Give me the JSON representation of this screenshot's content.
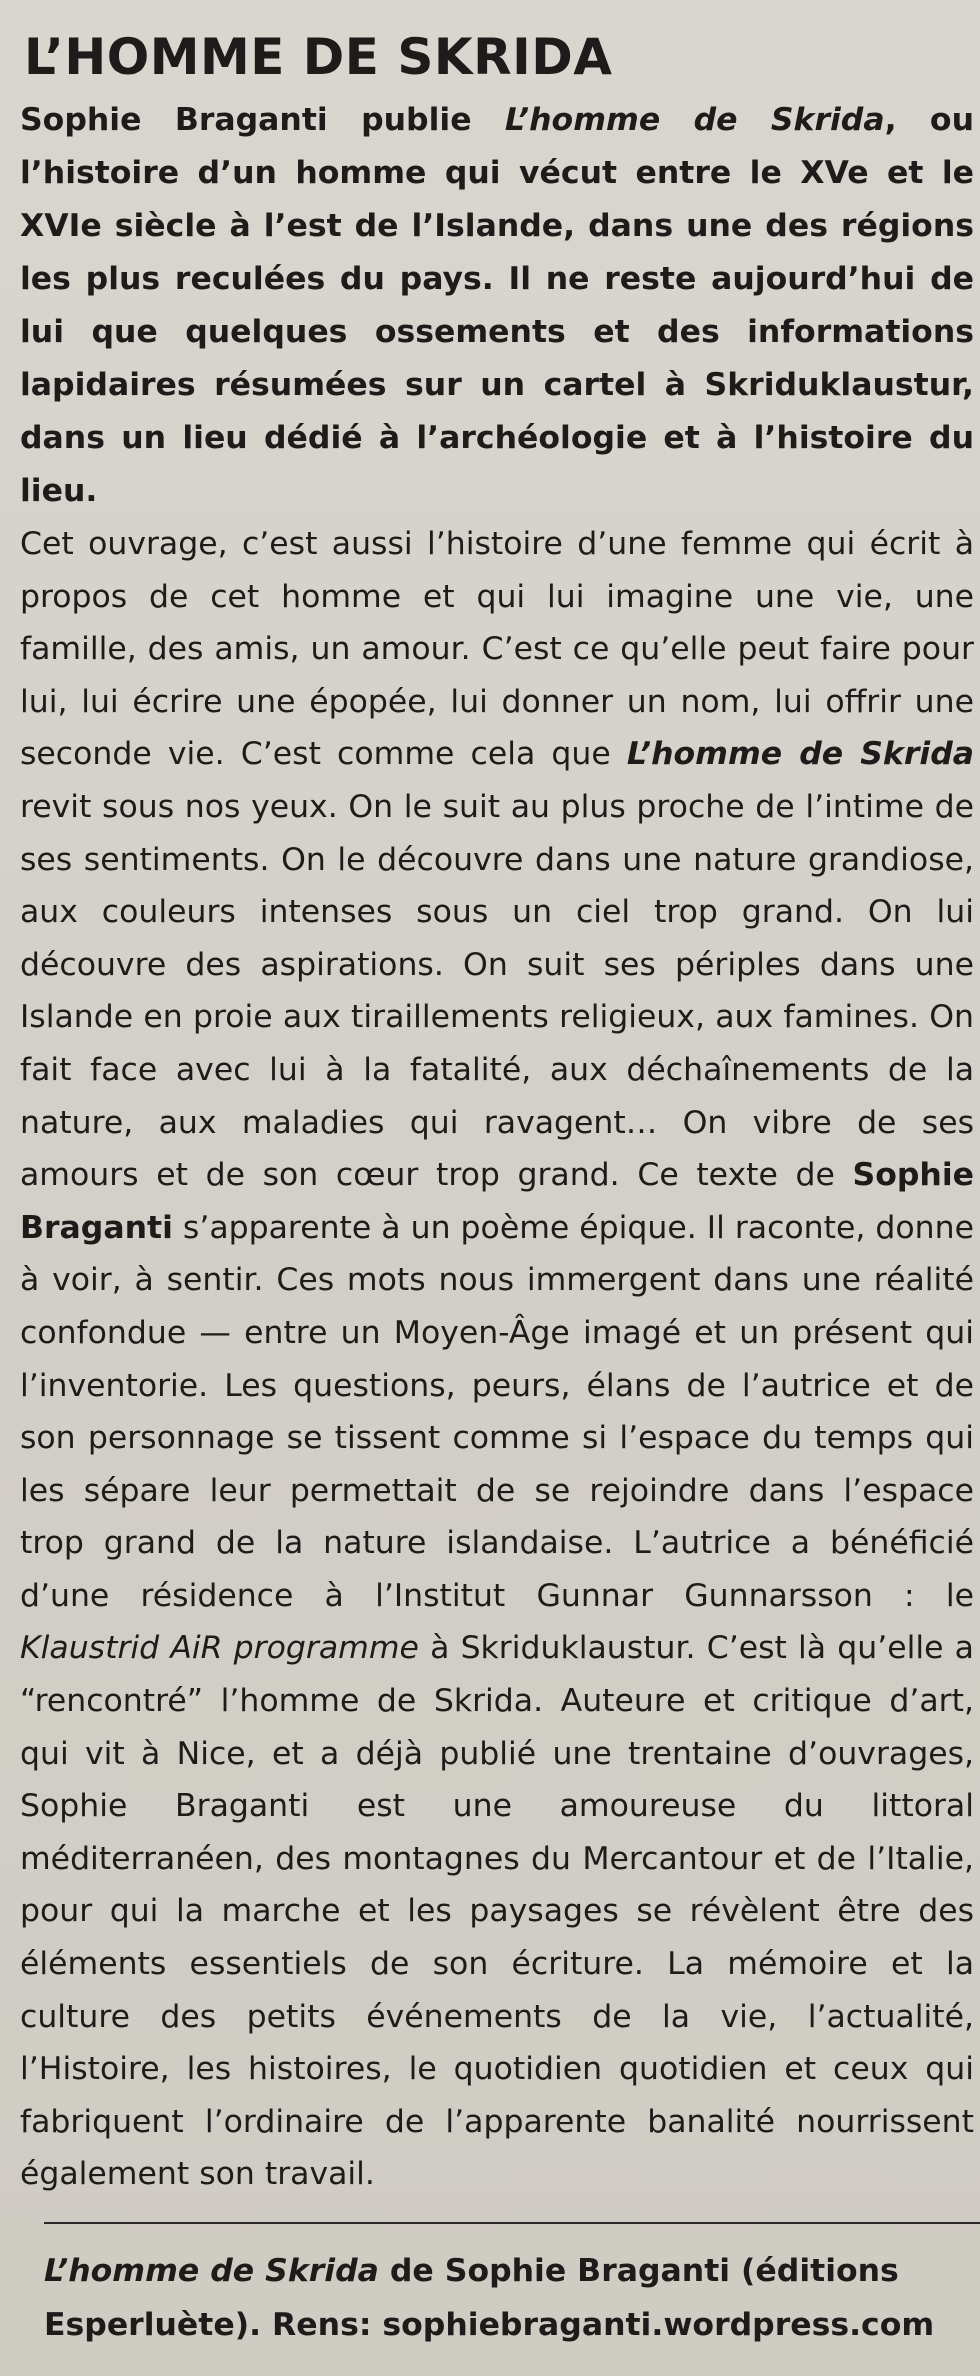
{
  "article": {
    "title": "L’HOMME DE SKRIDA",
    "intro": {
      "author": "Sophie Braganti",
      "verb": " publie ",
      "book_title": "L’homme de Skrida",
      "rest": ", ou l’histoire d’un homme qui vécut entre le XVe et le XVIe siècle à l’est de l’Islande, dans une des régions les plus reculées du pays. Il ne reste aujourd’hui de lui que quelques ossements et des informations lapidaires résumées sur un cartel à Skriduklaustur, dans un lieu dédié à l’archéologie et à l’histoire du lieu."
    },
    "body": {
      "p1": "Cet ouvrage, c’est aussi l’histoire d’une femme qui écrit à propos de cet homme et qui lui imagine une vie, une famille, des amis, un amour. C’est ce qu’elle peut faire pour lui, lui écrire une épopée, lui donner un nom, lui offrir une seconde vie. C’est comme cela que ",
      "book_title": "L’homme de Skrida",
      "p2": " revit sous nos yeux. On le suit au plus proche de l’intime de ses sentiments. On le découvre dans une nature grandiose, aux couleurs intenses sous un ciel trop grand. On lui découvre des aspirations. On suit ses périples dans une Islande en proie aux tiraillements religieux, aux famines. On fait face avec lui à la fatalité, aux déchaînements de la nature, aux maladies qui ravagent… On vibre de ses amours et de son cœur trop grand. Ce texte de ",
      "author": "Sophie Braganti",
      "p3": " s’apparente à un poème épique. Il raconte, donne à voir, à sentir. Ces mots nous immergent dans une réalité confondue — entre un Moyen-Âge imagé et un présent qui l’inventorie. Les questions, peurs, élans de l’autrice et de son personnage se tissent comme si l’espace du temps qui les sépare leur permettait de se rejoindre dans l’espace trop grand de la nature islandaise. L’autrice a bénéficié d’une résidence à l’Institut Gunnar Gunnarsson : le ",
      "programme": "Klaustrid AiR programme",
      "p4": " à Skriduklaustur. C’est là qu’elle a “rencontré” l’homme de Skrida. Auteure et critique d’art, qui vit à Nice, et a déjà publié une trentaine d’ouvrages, Sophie Braganti est une amoureuse du littoral méditerranéen, des montagnes du Mercantour et de l’Italie, pour qui la marche et les paysages se révèlent être des éléments essentiels de son écriture. La mémoire et la culture des petits événements de la vie, l’actualité, l’Histoire, les histoires, le quotidien quotidien et ceux qui fabriquent l’ordinaire de l’apparente banalité nourrissent également son travail."
    },
    "credit": {
      "book_title": "L’homme de Skrida",
      "rest": " de Sophie Braganti (éditions Esperluète). Rens: sophiebraganti.wordpress.com"
    }
  }
}
